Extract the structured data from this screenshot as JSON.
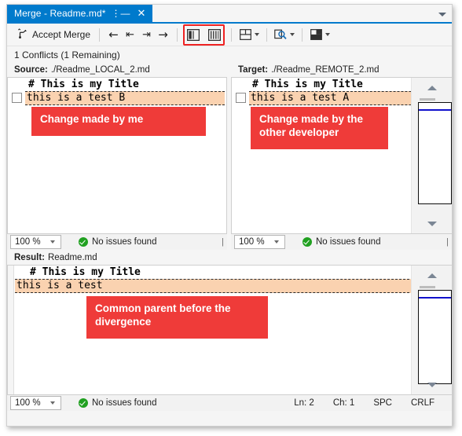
{
  "window": {
    "tab_title": "Merge - Readme.md*",
    "pin_icon": "pin-icon",
    "close_icon": "close-icon",
    "overflow_icon": "chevron-down-icon"
  },
  "toolbar": {
    "accept_merge_label": "Accept Merge",
    "accept_merge_icon": "merge-icon",
    "nav_prev_icon": "arrow-left-icon",
    "nav_first_icon": "arrow-to-start-icon",
    "nav_last_icon": "arrow-to-end-icon",
    "nav_next_icon": "arrow-right-icon",
    "layout_vertical_icon": "split-vertical-icon",
    "layout_columns_icon": "split-columns-icon",
    "layout_grid_icon": "layout-grid-icon",
    "inspect_icon": "zoom-document-icon",
    "panes_icon": "layout-panes-icon",
    "highlight_color": "#ee2222"
  },
  "conflicts": {
    "summary": "1 Conflicts (1 Remaining)"
  },
  "source_pane": {
    "label": "Source:",
    "file": "./Readme_LOCAL_2.md",
    "lines": [
      "# This is my Title",
      "this is a test B"
    ],
    "annotation": "Change made by me",
    "status": {
      "zoom": "100 %",
      "issues": "No issues found",
      "issues_icon": "check-circle-icon"
    }
  },
  "target_pane": {
    "label": "Target:",
    "file": "./Readme_REMOTE_2.md",
    "lines": [
      "# This is my Title",
      "this is a test A"
    ],
    "annotation": "Change made by the other developer",
    "status": {
      "zoom": "100 %",
      "issues": "No issues found",
      "issues_icon": "check-circle-icon"
    }
  },
  "result_pane": {
    "label": "Result:",
    "file": "Readme.md",
    "lines": [
      "# This is my Title",
      "this is a test"
    ],
    "annotation": "Common parent before the divergence",
    "status": {
      "zoom": "100 %",
      "issues": "No issues found",
      "issues_icon": "check-circle-icon",
      "line": "Ln: 2",
      "column": "Ch: 1",
      "indent": "SPC",
      "eol": "CRLF"
    }
  },
  "colors": {
    "tab_active": "#007acc",
    "conflict_highlight": "#fad2b0",
    "annotation_red": "#ef3b39",
    "ok_green": "#20a020"
  }
}
